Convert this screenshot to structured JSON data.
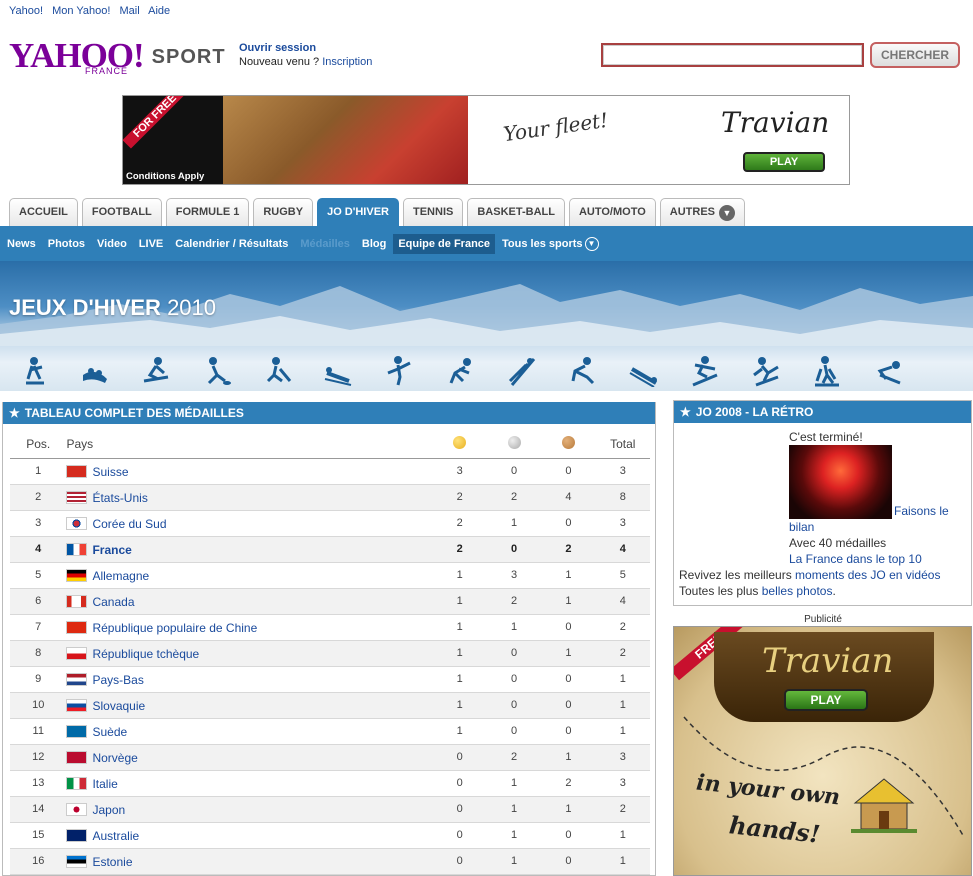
{
  "toplinks": {
    "yahoo": "Yahoo!",
    "mon_yahoo": "Mon Yahoo!",
    "mail": "Mail",
    "aide": "Aide"
  },
  "logo": {
    "brand": "YAHOO!",
    "country": "FRANCE",
    "section": "SPORT"
  },
  "session": {
    "open": "Ouvrir session",
    "new_prefix": "Nouveau venu ?",
    "signup": "Inscription"
  },
  "search": {
    "button": "CHERCHER",
    "value": ""
  },
  "banner": {
    "ribbon": "FOR FREE",
    "conditions": "Conditions Apply",
    "tagline": "Your fleet!",
    "brand": "Travian",
    "play": "PLAY"
  },
  "tabs": [
    "ACCUEIL",
    "FOOTBALL",
    "FORMULE 1",
    "RUGBY",
    "JO D'HIVER",
    "TENNIS",
    "BASKET-BALL",
    "AUTO/MOTO",
    "AUTRES"
  ],
  "subnav": [
    "News",
    "Photos",
    "Video",
    "LIVE",
    "Calendrier / Résultats",
    "Médailles",
    "Blog",
    "Equipe de France",
    "Tous les sports"
  ],
  "hero": {
    "title_bold": "JEUX D'HIVER",
    "title_year": "2010"
  },
  "medals": {
    "heading": "TABLEAU COMPLET DES MÉDAILLES",
    "columns": {
      "pos": "Pos.",
      "country": "Pays",
      "total": "Total"
    },
    "colors": {
      "gold": "#e8b020",
      "silver": "#aaaaaa",
      "bronze": "#b87a3a"
    },
    "rows": [
      {
        "pos": "1",
        "country": "Suisse",
        "gold": "3",
        "silver": "0",
        "bronze": "0",
        "total": "3"
      },
      {
        "pos": "2",
        "country": "États-Unis",
        "gold": "2",
        "silver": "2",
        "bronze": "4",
        "total": "8"
      },
      {
        "pos": "3",
        "country": "Corée du Sud",
        "gold": "2",
        "silver": "1",
        "bronze": "0",
        "total": "3"
      },
      {
        "pos": "4",
        "country": "France",
        "gold": "2",
        "silver": "0",
        "bronze": "2",
        "total": "4"
      },
      {
        "pos": "5",
        "country": "Allemagne",
        "gold": "1",
        "silver": "3",
        "bronze": "1",
        "total": "5"
      },
      {
        "pos": "6",
        "country": "Canada",
        "gold": "1",
        "silver": "2",
        "bronze": "1",
        "total": "4"
      },
      {
        "pos": "7",
        "country": "République populaire de Chine",
        "gold": "1",
        "silver": "1",
        "bronze": "0",
        "total": "2"
      },
      {
        "pos": "8",
        "country": "République tchèque",
        "gold": "1",
        "silver": "0",
        "bronze": "1",
        "total": "2"
      },
      {
        "pos": "9",
        "country": "Pays-Bas",
        "gold": "1",
        "silver": "0",
        "bronze": "0",
        "total": "1"
      },
      {
        "pos": "10",
        "country": "Slovaquie",
        "gold": "1",
        "silver": "0",
        "bronze": "0",
        "total": "1"
      },
      {
        "pos": "11",
        "country": "Suède",
        "gold": "1",
        "silver": "0",
        "bronze": "0",
        "total": "1"
      },
      {
        "pos": "12",
        "country": "Norvège",
        "gold": "0",
        "silver": "2",
        "bronze": "1",
        "total": "3"
      },
      {
        "pos": "13",
        "country": "Italie",
        "gold": "0",
        "silver": "1",
        "bronze": "2",
        "total": "3"
      },
      {
        "pos": "14",
        "country": "Japon",
        "gold": "0",
        "silver": "1",
        "bronze": "1",
        "total": "2"
      },
      {
        "pos": "15",
        "country": "Australie",
        "gold": "0",
        "silver": "1",
        "bronze": "0",
        "total": "1"
      },
      {
        "pos": "16",
        "country": "Estonie",
        "gold": "0",
        "silver": "1",
        "bronze": "0",
        "total": "1"
      }
    ]
  },
  "retro": {
    "heading": "JO 2008 - LA RÉTRO",
    "done": "C'est terminé!",
    "bilan": "Faisons le bilan",
    "medals_count": "Avec 40 médailles",
    "top10": "La France dans le top 10",
    "revivez_prefix": "Revivez les meilleurs",
    "revivez_link": "moments des JO en vidéos",
    "photos_prefix": "Toutes les plus",
    "photos_link": "belles photos",
    "photos_suffix": "."
  },
  "ad": {
    "label": "Publicité",
    "free": "FREE",
    "brand": "Travian",
    "play": "PLAY",
    "line1": "in your own",
    "line2": "hands!"
  }
}
